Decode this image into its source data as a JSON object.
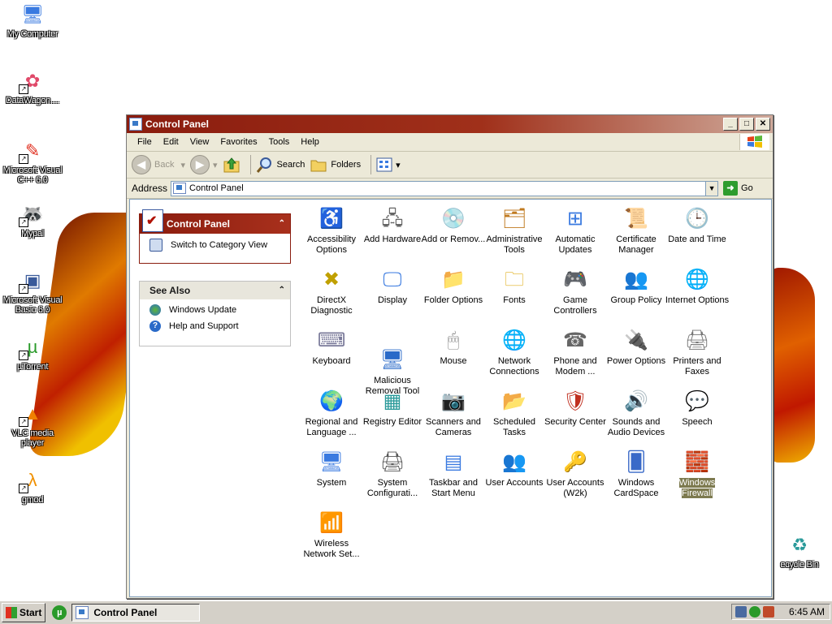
{
  "desktop": {
    "icons": [
      {
        "label": "My Computer",
        "icon": "computer-icon",
        "shortcut": false
      },
      {
        "label": "DataWagon....",
        "icon": "datawagon-icon",
        "shortcut": true
      },
      {
        "label": "Microsoft Visual C++ 6.0",
        "icon": "visual-cpp-icon",
        "shortcut": true
      },
      {
        "label": "Mypal",
        "icon": "mypal-icon",
        "shortcut": true
      },
      {
        "label": "Microsoft Visual Basic 6.0",
        "icon": "visual-basic-icon",
        "shortcut": true
      },
      {
        "label": "µTorrent",
        "icon": "utorrent-icon",
        "shortcut": true
      },
      {
        "label": "VLC media player",
        "icon": "vlc-icon",
        "shortcut": true
      },
      {
        "label": "gmod",
        "icon": "gmod-icon",
        "shortcut": true
      },
      {
        "label": "ecycle Bin",
        "icon": "recycle-bin-icon",
        "shortcut": false
      }
    ]
  },
  "window": {
    "title": "Control Panel",
    "menu": [
      "File",
      "Edit",
      "View",
      "Favorites",
      "Tools",
      "Help"
    ],
    "toolbar": {
      "back": "Back",
      "search": "Search",
      "folders": "Folders"
    },
    "address": {
      "label": "Address",
      "value": "Control Panel",
      "go": "Go"
    },
    "task_pane": {
      "main_title": "Control Panel",
      "switch_view": "Switch to Category View",
      "see_also_title": "See Also",
      "see_also": [
        "Windows Update",
        "Help and Support"
      ]
    },
    "items": [
      {
        "label": "Accessibility Options",
        "icon": "accessibility-icon"
      },
      {
        "label": "Add Hardware",
        "icon": "add-hardware-icon"
      },
      {
        "label": "Add or Remov...",
        "icon": "add-remove-programs-icon"
      },
      {
        "label": "Administrative Tools",
        "icon": "administrative-tools-icon"
      },
      {
        "label": "Automatic Updates",
        "icon": "automatic-updates-icon"
      },
      {
        "label": "Certificate Manager",
        "icon": "certificate-icon"
      },
      {
        "label": "Date and Time",
        "icon": "date-time-icon"
      },
      {
        "label": "DirectX Diagnostic",
        "icon": "directx-icon"
      },
      {
        "label": "Display",
        "icon": "display-icon"
      },
      {
        "label": "Folder Options",
        "icon": "folder-options-icon"
      },
      {
        "label": "Fonts",
        "icon": "fonts-icon"
      },
      {
        "label": "Game Controllers",
        "icon": "game-controller-icon"
      },
      {
        "label": "Group Policy",
        "icon": "group-policy-icon"
      },
      {
        "label": "Internet Options",
        "icon": "internet-options-icon"
      },
      {
        "label": "Keyboard",
        "icon": "keyboard-icon"
      },
      {
        "label": "Malicious Removal Tool",
        "icon": "malicious-removal-icon"
      },
      {
        "label": "Mouse",
        "icon": "mouse-icon"
      },
      {
        "label": "Network Connections",
        "icon": "network-icon"
      },
      {
        "label": "Phone and Modem ...",
        "icon": "phone-modem-icon"
      },
      {
        "label": "Power Options",
        "icon": "power-icon"
      },
      {
        "label": "Printers and Faxes",
        "icon": "printer-icon"
      },
      {
        "label": "Regional and Language ...",
        "icon": "regional-icon"
      },
      {
        "label": "Registry Editor",
        "icon": "registry-icon"
      },
      {
        "label": "Scanners and Cameras",
        "icon": "scanner-icon"
      },
      {
        "label": "Scheduled Tasks",
        "icon": "scheduled-tasks-icon"
      },
      {
        "label": "Security Center",
        "icon": "security-icon"
      },
      {
        "label": "Sounds and Audio Devices",
        "icon": "sound-icon"
      },
      {
        "label": "Speech",
        "icon": "speech-icon"
      },
      {
        "label": "System",
        "icon": "system-icon"
      },
      {
        "label": "System Configurati...",
        "icon": "system-config-icon"
      },
      {
        "label": "Taskbar and Start Menu",
        "icon": "taskbar-icon"
      },
      {
        "label": "User Accounts",
        "icon": "user-accounts-icon"
      },
      {
        "label": "User Accounts (W2k)",
        "icon": "user-accounts-w2k-icon"
      },
      {
        "label": "Windows CardSpace",
        "icon": "cardspace-icon"
      },
      {
        "label": "Windows Firewall",
        "icon": "firewall-icon",
        "selected": true
      },
      {
        "label": "Wireless Network Set...",
        "icon": "wireless-icon"
      }
    ]
  },
  "taskbar": {
    "start": "Start",
    "task": "Control Panel",
    "clock": "6:45 AM"
  },
  "colors": {
    "title_bar": "#8a1c0e",
    "selection": "#7d7a4f",
    "window_face": "#ece9d8"
  }
}
